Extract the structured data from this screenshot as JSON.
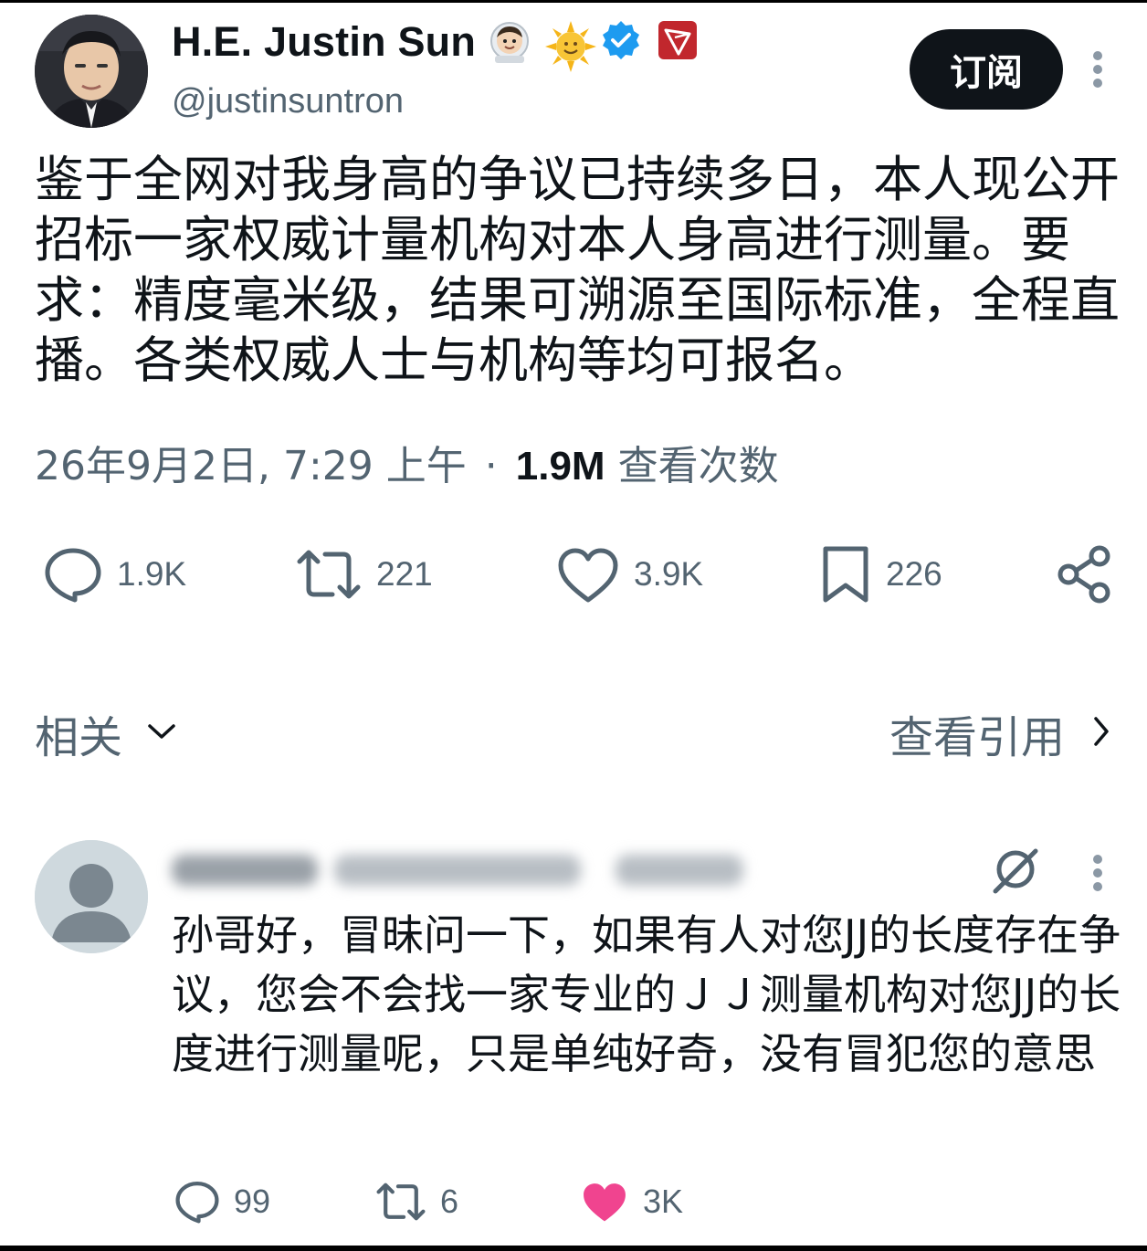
{
  "tweet": {
    "author": {
      "display_name": "H.E. Justin Sun",
      "handle": "@justinsuntron",
      "badges": [
        "astronaut-emoji",
        "sun-emoji",
        "verified-badge-icon",
        "tron-logo-badge"
      ]
    },
    "subscribe_label": "订阅",
    "text": "鉴于全网对我身高的争议已持续多日，本人现公开招标一家权威计量机构对本人身高进行测量。要求：精度毫米级，结果可溯源至国际标准，全程直播。各类权威人士与机构等均可报名。",
    "timestamp": "26年9月2日, 7:29 上午",
    "separator": "·",
    "views_count": "1.9M",
    "views_label": "查看次数",
    "stats": {
      "replies": "1.9K",
      "reposts": "221",
      "likes": "3.9K",
      "bookmarks": "226"
    }
  },
  "sections": {
    "related_label": "相关",
    "quotes_label": "查看引用"
  },
  "reply": {
    "text": "孙哥好，冒昧问一下，如果有人对您JJ的长度存在争议，您会不会找一家专业的ＪＪ测量机构对您JJ的长度进行测量呢，只是单纯好奇，没有冒犯您的意思",
    "stats": {
      "replies": "99",
      "reposts": "6",
      "likes": "3K"
    },
    "liked_color": "#f91880"
  },
  "colors": {
    "text_primary": "#0f1419",
    "text_secondary": "#536471",
    "verified_blue": "#1d9bf0",
    "tron_red": "#c1272d"
  }
}
